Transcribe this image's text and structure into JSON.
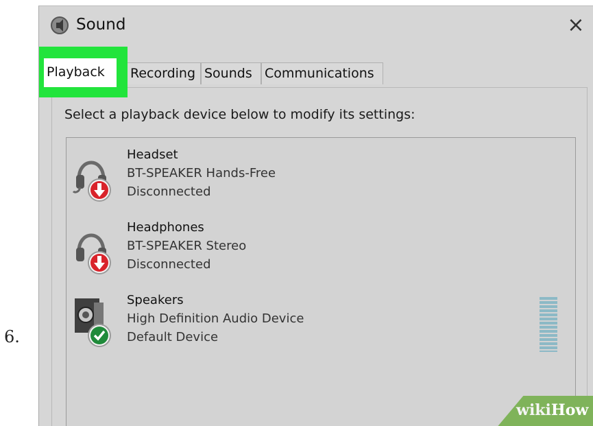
{
  "step": {
    "number": "6."
  },
  "window": {
    "title": "Sound",
    "close_glyph": "×",
    "title_icon": "speaker-icon"
  },
  "tabs": [
    {
      "label": "Playback",
      "active": true
    },
    {
      "label": "Recording",
      "active": false
    },
    {
      "label": "Sounds",
      "active": false
    },
    {
      "label": "Communications",
      "active": false
    }
  ],
  "tabs_display": {
    "recording_visible": "Recording"
  },
  "panel": {
    "instruction": "Select a playback device below to modify its settings:"
  },
  "devices": [
    {
      "name": "Headset",
      "description": "BT-SPEAKER Hands-Free",
      "status": "Disconnected",
      "icon": "headset-icon",
      "badge": "disconnected-badge-icon"
    },
    {
      "name": "Headphones",
      "description": "BT-SPEAKER Stereo",
      "status": "Disconnected",
      "icon": "headphones-icon",
      "badge": "disconnected-badge-icon"
    },
    {
      "name": "Speakers",
      "description": "High Definition Audio Device",
      "status": "Default Device",
      "icon": "speakers-icon",
      "badge": "default-check-icon"
    }
  ],
  "watermark": {
    "part1": "wiki",
    "part2": "How"
  },
  "colors": {
    "highlight": "#22e43c",
    "window_bg": "#d6d6d6",
    "disconnected_badge": "#d9232b",
    "default_badge": "#1f8a3a",
    "level_meter": "#8cb9c6",
    "watermark": "#7fb35a"
  }
}
